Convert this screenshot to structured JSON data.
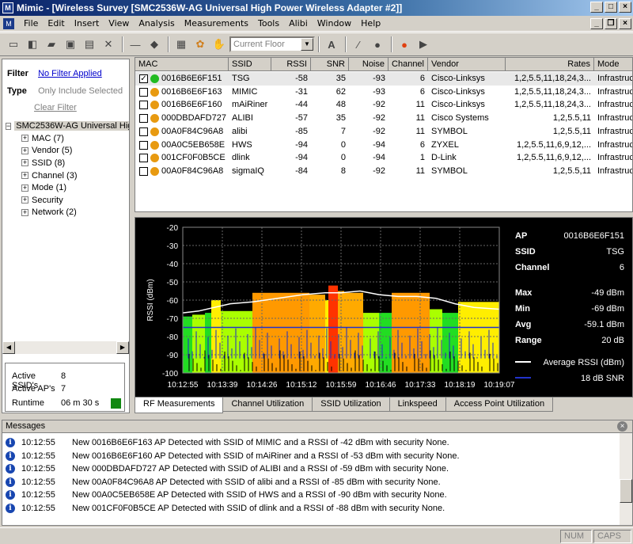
{
  "window": {
    "title": "Mimic - [Wireless Survey [SMC2536W-AG Universal High Power Wireless Adapter #2]]",
    "app_icon": "mimic-app-icon"
  },
  "menu": [
    "File",
    "Edit",
    "Insert",
    "View",
    "Analysis",
    "Measurements",
    "Tools",
    "Alibi",
    "Window",
    "Help"
  ],
  "toolbar": {
    "floor_placeholder": "Current Floor"
  },
  "filter": {
    "filter_label": "Filter",
    "filter_value": "No Filter Applied",
    "type_label": "Type",
    "type_value": "Only Include Selected",
    "clear": "Clear Filter"
  },
  "tree": {
    "root": "SMC2536W-AG Universal High Power Wireless Adapter #2",
    "nodes": [
      "MAC (7)",
      "Vendor (5)",
      "SSID (8)",
      "Channel (3)",
      "Mode (1)",
      "Security",
      "Network (2)"
    ]
  },
  "stats": {
    "ssids_label": "Active SSID's",
    "ssids": "8",
    "aps_label": "Active AP's",
    "aps": "7",
    "runtime_label": "Runtime",
    "runtime": "06 m 30 s"
  },
  "table": {
    "columns": [
      "MAC",
      "SSID",
      "RSSI",
      "SNR",
      "Noise",
      "Channel",
      "Vendor",
      "Rates",
      "Mode"
    ],
    "rows": [
      {
        "checked": true,
        "dot": "#22bb22",
        "mac": "0016B6E6F151",
        "ssid": "TSG",
        "rssi": "-58",
        "snr": "35",
        "noise": "-93",
        "channel": "6",
        "vendor": "Cisco-Linksys",
        "rates": "1,2,5.5,11,18,24,3...",
        "mode": "Infrastructure"
      },
      {
        "checked": false,
        "dot": "#e89a10",
        "mac": "0016B6E6F163",
        "ssid": "MIMIC",
        "rssi": "-31",
        "snr": "62",
        "noise": "-93",
        "channel": "6",
        "vendor": "Cisco-Linksys",
        "rates": "1,2,5.5,11,18,24,3...",
        "mode": "Infrastructure"
      },
      {
        "checked": false,
        "dot": "#e89a10",
        "mac": "0016B6E6F160",
        "ssid": "mAiRiner",
        "rssi": "-44",
        "snr": "48",
        "noise": "-92",
        "channel": "11",
        "vendor": "Cisco-Linksys",
        "rates": "1,2,5.5,11,18,24,3...",
        "mode": "Infrastructure"
      },
      {
        "checked": false,
        "dot": "#e89a10",
        "mac": "000DBDAFD727",
        "ssid": "ALIBI",
        "rssi": "-57",
        "snr": "35",
        "noise": "-92",
        "channel": "11",
        "vendor": "Cisco Systems",
        "rates": "1,2,5.5,11",
        "mode": "Infrastructure"
      },
      {
        "checked": false,
        "dot": "#e89a10",
        "mac": "00A0F84C96A8",
        "ssid": "alibi",
        "rssi": "-85",
        "snr": "7",
        "noise": "-92",
        "channel": "11",
        "vendor": "SYMBOL",
        "rates": "1,2,5.5,11",
        "mode": "Infrastructure"
      },
      {
        "checked": false,
        "dot": "#e89a10",
        "mac": "00A0C5EB658E",
        "ssid": "HWS",
        "rssi": "-94",
        "snr": "0",
        "noise": "-94",
        "channel": "6",
        "vendor": "ZYXEL",
        "rates": "1,2,5.5,11,6,9,12,...",
        "mode": "Infrastructure"
      },
      {
        "checked": false,
        "dot": "#e89a10",
        "mac": "001CF0F0B5CE",
        "ssid": "dlink",
        "rssi": "-94",
        "snr": "0",
        "noise": "-94",
        "channel": "1",
        "vendor": "D-Link",
        "rates": "1,2,5.5,11,6,9,12,...",
        "mode": "Infrastructure"
      },
      {
        "checked": false,
        "dot": "#e89a10",
        "mac": "00A0F84C96A8",
        "ssid": "sigmaIQ",
        "rssi": "-84",
        "snr": "8",
        "noise": "-92",
        "channel": "11",
        "vendor": "SYMBOL",
        "rates": "1,2,5.5,11",
        "mode": "Infrastructure"
      }
    ]
  },
  "chart_data": {
    "type": "bar",
    "ylabel": "RSSI (dBm)",
    "ylim": [
      -100,
      -20
    ],
    "yticks": [
      -20,
      -30,
      -40,
      -50,
      -60,
      -70,
      -80,
      -90,
      -100
    ],
    "xticks": [
      "10:12:55",
      "10:13:39",
      "10:14:26",
      "10:15:12",
      "10:15:59",
      "10:16:46",
      "10:17:33",
      "10:18:19",
      "10:19:07"
    ],
    "grid": true,
    "segments": [
      {
        "t0": 0.0,
        "t1": 0.03,
        "top": -69,
        "color": "#22dd22"
      },
      {
        "t0": 0.03,
        "t1": 0.07,
        "top": -68,
        "color": "#aaff00"
      },
      {
        "t0": 0.07,
        "t1": 0.09,
        "top": -67,
        "color": "#22dd22"
      },
      {
        "t0": 0.09,
        "t1": 0.12,
        "top": -60,
        "color": "#ffee00"
      },
      {
        "t0": 0.12,
        "t1": 0.22,
        "top": -66,
        "color": "#aaff00"
      },
      {
        "t0": 0.22,
        "t1": 0.4,
        "top": -56,
        "color": "#ff9900"
      },
      {
        "t0": 0.4,
        "t1": 0.45,
        "top": -57,
        "color": "#ffaa00"
      },
      {
        "t0": 0.45,
        "t1": 0.46,
        "top": -60,
        "color": "#ffee00"
      },
      {
        "t0": 0.46,
        "t1": 0.49,
        "top": -52,
        "color": "#ff3300"
      },
      {
        "t0": 0.49,
        "t1": 0.51,
        "top": -55,
        "color": "#ffaa00"
      },
      {
        "t0": 0.51,
        "t1": 0.57,
        "top": -56,
        "color": "#ffaa00"
      },
      {
        "t0": 0.57,
        "t1": 0.62,
        "top": -67,
        "color": "#aaff00"
      },
      {
        "t0": 0.62,
        "t1": 0.66,
        "top": -67,
        "color": "#22dd22"
      },
      {
        "t0": 0.66,
        "t1": 0.78,
        "top": -56,
        "color": "#ff9900"
      },
      {
        "t0": 0.78,
        "t1": 0.82,
        "top": -65,
        "color": "#aaff00"
      },
      {
        "t0": 0.82,
        "t1": 0.87,
        "top": -67,
        "color": "#22dd22"
      },
      {
        "t0": 0.87,
        "t1": 1.0,
        "top": -61,
        "color": "#ffee00"
      }
    ],
    "series": [
      {
        "name": "Average RSSI (dBm)",
        "color": "#ffffff",
        "x": [
          0.0,
          0.05,
          0.1,
          0.15,
          0.22,
          0.3,
          0.38,
          0.45,
          0.5,
          0.56,
          0.62,
          0.68,
          0.74,
          0.8,
          0.86,
          0.92,
          1.0
        ],
        "y": [
          -67,
          -66,
          -64,
          -62,
          -61,
          -59,
          -57,
          -56,
          -56,
          -55,
          -57,
          -58,
          -58,
          -59,
          -62,
          -64,
          -65
        ]
      },
      {
        "name": "18 dB SNR",
        "color": "#2233cc",
        "y_const": -75
      }
    ]
  },
  "chart_info": [
    {
      "label": "AP",
      "value": "0016B6E6F151"
    },
    {
      "label": "SSID",
      "value": "TSG"
    },
    {
      "label": "Channel",
      "value": "6"
    },
    {
      "label": "Max",
      "value": "-49 dBm"
    },
    {
      "label": "Min",
      "value": "-69 dBm"
    },
    {
      "label": "Avg",
      "value": "-59.1 dBm"
    },
    {
      "label": "Range",
      "value": "20 dB"
    }
  ],
  "legend": [
    {
      "label": "Average RSSI (dBm)",
      "color": "#ffffff"
    },
    {
      "label": "18 dB SNR",
      "color": "#2233cc"
    }
  ],
  "tabs": [
    "RF Measurements",
    "Channel Utilization",
    "SSID Utilization",
    "Linkspeed",
    "Access Point Utilization"
  ],
  "messages": {
    "title": "Messages",
    "items": [
      {
        "time": "10:12:55",
        "text": "New 0016B6E6F163 AP Detected with SSID of MIMIC and a RSSI of -42 dBm with security None."
      },
      {
        "time": "10:12:55",
        "text": "New 0016B6E6F160 AP Detected with SSID of mAiRiner and a RSSI of -53 dBm with security None."
      },
      {
        "time": "10:12:55",
        "text": "New 000DBDAFD727 AP Detected with SSID of ALIBI and a RSSI of -59 dBm with security None."
      },
      {
        "time": "10:12:55",
        "text": "New 00A0F84C96A8 AP Detected with SSID of alibi and a RSSI of -85 dBm with security None."
      },
      {
        "time": "10:12:55",
        "text": "New 00A0C5EB658E AP Detected with SSID of HWS and a RSSI of -90 dBm with security None."
      },
      {
        "time": "10:12:55",
        "text": "New 001CF0F0B5CE AP Detected with SSID of dlink and a RSSI of -88 dBm with security None."
      }
    ]
  },
  "statusbar": {
    "num": "NUM",
    "caps": "CAPS"
  }
}
